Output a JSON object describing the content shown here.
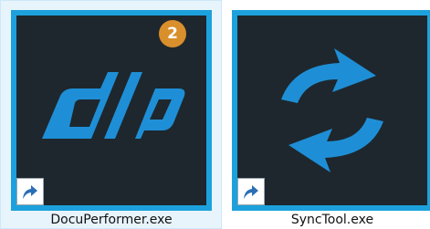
{
  "desktop": {
    "items": [
      {
        "filename": "DocuPerformer.exe",
        "icon": "docuperformer-logo-icon",
        "selected": true,
        "badge": "2",
        "shortcut_overlay": "shortcut-arrow-icon"
      },
      {
        "filename": "SyncTool.exe",
        "icon": "sync-arrows-icon",
        "selected": false,
        "shortcut_overlay": "shortcut-arrow-icon"
      }
    ]
  },
  "colors": {
    "tile_border": "#1da1dc",
    "tile_background": "#1e272e",
    "logo_blue": "#1e8fd6",
    "badge": "#d98f2b",
    "selection": "#e8f4fc"
  }
}
